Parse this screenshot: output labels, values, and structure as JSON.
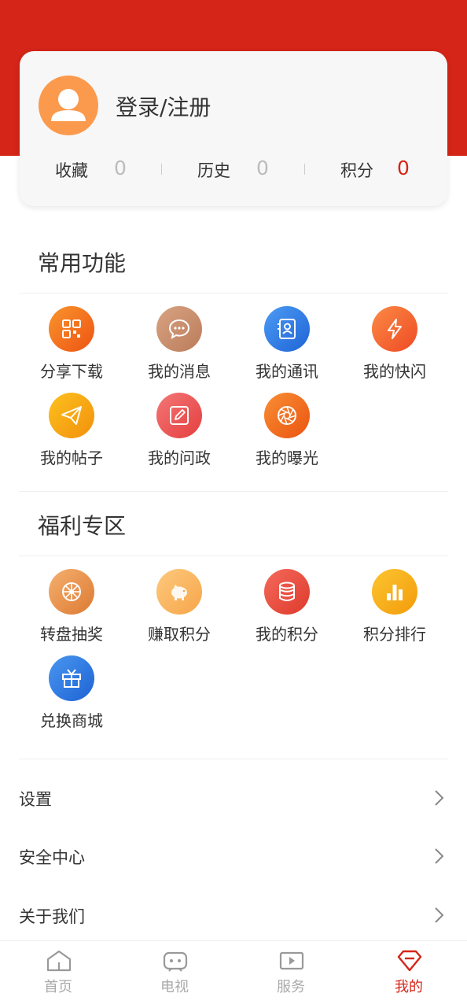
{
  "profile": {
    "login_label": "登录/注册",
    "stats": [
      {
        "label": "收藏",
        "value": "0"
      },
      {
        "label": "历史",
        "value": "0"
      },
      {
        "label": "积分",
        "value": "0"
      }
    ]
  },
  "common": {
    "title": "常用功能",
    "items": [
      {
        "label": "分享下载",
        "icon": "qr-code-icon",
        "color": "#f46b1f"
      },
      {
        "label": "我的消息",
        "icon": "chat-bubble-icon",
        "color": "#c68c6a"
      },
      {
        "label": "我的通讯",
        "icon": "contacts-icon",
        "color": "#2f7fe6"
      },
      {
        "label": "我的快闪",
        "icon": "lightning-icon",
        "color": "#f6622b"
      },
      {
        "label": "我的帖子",
        "icon": "paper-plane-icon",
        "color": "#f7a20f"
      },
      {
        "label": "我的问政",
        "icon": "edit-icon",
        "color": "#ee5555"
      },
      {
        "label": "我的曝光",
        "icon": "aperture-icon",
        "color": "#f36b1d"
      }
    ]
  },
  "welfare": {
    "title": "福利专区",
    "items": [
      {
        "label": "转盘抽奖",
        "icon": "wheel-icon",
        "color": "#e8914a"
      },
      {
        "label": "赚取积分",
        "icon": "piggy-bank-icon",
        "color": "#fbb463"
      },
      {
        "label": "我的积分",
        "icon": "coins-icon",
        "color": "#ea4e3f"
      },
      {
        "label": "积分排行",
        "icon": "bar-chart-icon",
        "color": "#f7b111"
      },
      {
        "label": "兑换商城",
        "icon": "gift-icon",
        "color": "#2d79e2"
      }
    ]
  },
  "menu": [
    {
      "label": "设置"
    },
    {
      "label": "安全中心"
    },
    {
      "label": "关于我们"
    }
  ],
  "tabs": [
    {
      "label": "首页",
      "icon": "home-icon"
    },
    {
      "label": "电视",
      "icon": "tv-icon"
    },
    {
      "label": "服务",
      "icon": "play-screen-icon"
    },
    {
      "label": "我的",
      "icon": "diamond-icon",
      "active": true
    }
  ],
  "colors": {
    "brand_red": "#d42518"
  }
}
